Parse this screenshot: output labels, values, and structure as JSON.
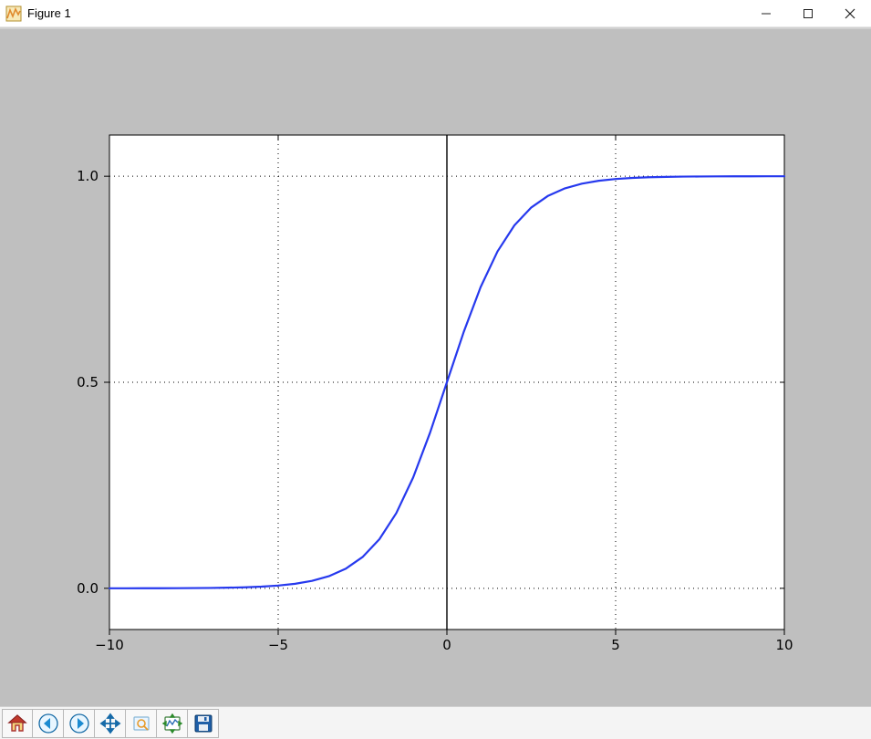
{
  "window": {
    "title": "Figure 1"
  },
  "toolbar": {
    "buttons": [
      {
        "name": "home-button",
        "label": "Home"
      },
      {
        "name": "back-button",
        "label": "Back"
      },
      {
        "name": "forward-button",
        "label": "Forward"
      },
      {
        "name": "pan-button",
        "label": "Pan"
      },
      {
        "name": "zoom-button",
        "label": "Zoom"
      },
      {
        "name": "subplots-button",
        "label": "Configure subplots"
      },
      {
        "name": "save-button",
        "label": "Save"
      }
    ]
  },
  "chart_data": {
    "type": "line",
    "title": "",
    "xlabel": "",
    "ylabel": "",
    "xlim": [
      -10,
      10
    ],
    "ylim": [
      -0.1,
      1.1
    ],
    "xticks": [
      -10,
      -5,
      0,
      5,
      10
    ],
    "yticks": [
      0.0,
      0.5,
      1.0
    ],
    "grid": "dotted",
    "axis_cross_at_zero": true,
    "line_color": "#2639ee",
    "x": [
      -10,
      -9.5,
      -9,
      -8.5,
      -8,
      -7.5,
      -7,
      -6.5,
      -6,
      -5.5,
      -5,
      -4.5,
      -4,
      -3.5,
      -3,
      -2.5,
      -2,
      -1.5,
      -1,
      -0.5,
      0,
      0.5,
      1,
      1.5,
      2,
      2.5,
      3,
      3.5,
      4,
      4.5,
      5,
      5.5,
      6,
      6.5,
      7,
      7.5,
      8,
      8.5,
      9,
      9.5,
      10
    ],
    "values": [
      5e-05,
      7e-05,
      0.00012,
      0.0002,
      0.00034,
      0.00055,
      0.00091,
      0.0015,
      0.00247,
      0.00407,
      0.00669,
      0.01099,
      0.01799,
      0.02931,
      0.04743,
      0.07586,
      0.1192,
      0.18243,
      0.26894,
      0.37754,
      0.5,
      0.62246,
      0.73106,
      0.81757,
      0.8808,
      0.92414,
      0.95257,
      0.97069,
      0.98201,
      0.98901,
      0.99331,
      0.99593,
      0.99753,
      0.9985,
      0.99909,
      0.99945,
      0.99966,
      0.9998,
      0.99988,
      0.99993,
      0.99995
    ]
  },
  "tick_labels": {
    "x": [
      "−10",
      "−5",
      "0",
      "5",
      "10"
    ],
    "y": [
      "0.0",
      "0.5",
      "1.0"
    ]
  }
}
